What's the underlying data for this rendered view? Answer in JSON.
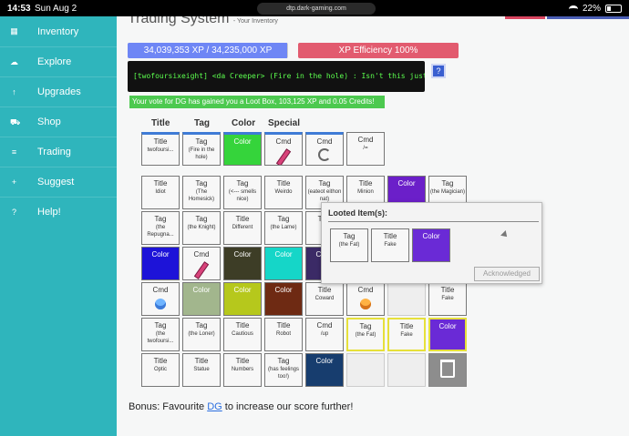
{
  "status": {
    "time": "14:53",
    "date": "Sun Aug 2",
    "url": "dtp.dark-gaming.com",
    "battery": "22%"
  },
  "nav": [
    {
      "label": "Inventory",
      "icon": "grid-icon",
      "glyph": "▦"
    },
    {
      "label": "Explore",
      "icon": "cloud-icon",
      "glyph": "☁"
    },
    {
      "label": "Upgrades",
      "icon": "arrow-up-icon",
      "glyph": "↑"
    },
    {
      "label": "Shop",
      "icon": "cart-icon",
      "glyph": "⛟"
    },
    {
      "label": "Trading",
      "icon": "list-icon",
      "glyph": "≡"
    },
    {
      "label": "Suggest",
      "icon": "plus-box-icon",
      "glyph": "+"
    },
    {
      "label": "Help!",
      "icon": "question-icon",
      "glyph": "?"
    }
  ],
  "header": {
    "title": "Trading System",
    "subtitle": "- Your Inventory"
  },
  "xp": {
    "text": "34,039,353 XP / 34,235,000 XP",
    "progress": 0.994
  },
  "efficiency": {
    "text": "XP Efficiency 100%"
  },
  "chat": {
    "text": "[twofoursixeight] <da Creeper> (Fire in the hole) : Isn't this just the best?"
  },
  "help_button": "?",
  "vote": "Your vote for DG has gained you a Loot Box, 103,125 XP and 0.05 Credits!",
  "columns": [
    "Title",
    "Tag",
    "Color",
    "Special"
  ],
  "equipped": [
    {
      "t": "Title",
      "s": "twofoursi..."
    },
    {
      "t": "Tag",
      "s": "(Fire in the hole)"
    },
    {
      "t": "Color",
      "color": "#35d43b"
    },
    {
      "t": "Cmd",
      "icon": "sword"
    },
    {
      "t": "Cmd",
      "icon": "potion-cycle"
    },
    {
      "t": "Cmd",
      "s": "/="
    }
  ],
  "grid": [
    [
      {
        "t": "Title",
        "s": "Idiot"
      },
      {
        "t": "Tag",
        "s": "(The Homesick)"
      },
      {
        "t": "Tag",
        "s": "(<--- smells nice)"
      },
      {
        "t": "Title",
        "s": "Weirdo"
      },
      {
        "t": "Tag",
        "s": "(eateot eithon nat)"
      },
      {
        "t": "Title",
        "s": "Minion"
      },
      {
        "t": "Color",
        "color": "#6b1fc9"
      },
      {
        "t": "Tag",
        "s": "(the Magician)"
      }
    ],
    [
      {
        "t": "Tag",
        "s": "(the Repugna..."
      },
      {
        "t": "Tag",
        "s": "(the Knight)"
      },
      {
        "t": "Title",
        "s": "Different"
      },
      {
        "t": "Tag",
        "s": "(the Lame)"
      },
      {
        "t": "Title",
        "s": ""
      },
      null,
      null,
      {
        "t": "Tag",
        "s": ""
      }
    ],
    [
      {
        "t": "Color",
        "color": "#1d13d8"
      },
      {
        "t": "Cmd",
        "icon": "sword"
      },
      {
        "t": "Color",
        "color": "#3d3d26"
      },
      {
        "t": "Color",
        "color": "#15d6c8"
      },
      {
        "t": "Color",
        "color": "#3b2a66"
      },
      null,
      null,
      null
    ],
    [
      {
        "t": "Cmd",
        "icon": "potion"
      },
      {
        "t": "Color",
        "color": "#a2b68d"
      },
      {
        "t": "Color",
        "color": "#b6c81c"
      },
      {
        "t": "Color",
        "color": "#6e2a13"
      },
      {
        "t": "Title",
        "s": "Coward"
      },
      {
        "t": "Cmd",
        "icon": "potion-orange"
      },
      {
        "t": "empty"
      },
      {
        "t": "Title",
        "s": "Fake"
      }
    ],
    [
      {
        "t": "Tag",
        "s": "(the twofoursi..."
      },
      {
        "t": "Tag",
        "s": "(the Loner)"
      },
      {
        "t": "Title",
        "s": "Cautious"
      },
      {
        "t": "Title",
        "s": "Robot"
      },
      {
        "t": "Cmd",
        "s": "/up"
      },
      {
        "t": "Tag",
        "s": "(the Fat)",
        "sel": true
      },
      {
        "t": "Title",
        "s": "Fake",
        "sel": true
      },
      {
        "t": "Color",
        "color": "#6a2ad6",
        "sel": true
      }
    ],
    [
      {
        "t": "Title",
        "s": "Optic"
      },
      {
        "t": "Title",
        "s": "Statue"
      },
      {
        "t": "Title",
        "s": "Numbers"
      },
      {
        "t": "Tag",
        "s": "(has feelings too!)"
      },
      {
        "t": "Color",
        "color": "#173d6e"
      },
      {
        "t": "empty"
      },
      {
        "t": "empty"
      },
      {
        "t": "trash"
      }
    ]
  ],
  "popup": {
    "title": "Looted Item(s):",
    "items": [
      {
        "t": "Tag",
        "s": "(the Fat)"
      },
      {
        "t": "Title",
        "s": "Fake"
      },
      {
        "t": "Color",
        "color": "#6a2ad6"
      }
    ],
    "ack": "Acknowledged"
  },
  "bonus": {
    "pre": "Bonus: Favourite ",
    "link": "DG",
    "post": " to increase our score further!"
  }
}
